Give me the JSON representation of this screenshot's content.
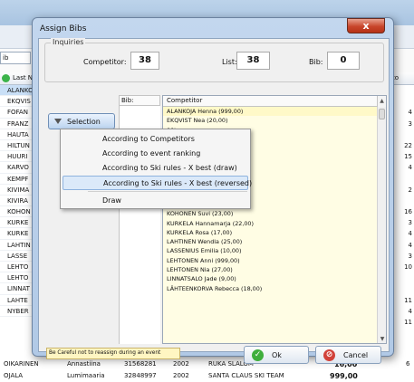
{
  "background_app": {
    "filter_text": "ib",
    "grid_header": "Last Na",
    "rows": [
      "ALANKO",
      "EKQVIS",
      "FOFAN",
      "FRANZ",
      "HAUTA",
      "HILTUN",
      "HUURI",
      "KARVO",
      "KEMPF",
      "KIVIMA",
      "KIVIRA",
      "KOHON",
      "KURKE",
      "KURKE",
      "LAHTIN",
      "LASSE",
      "LEHTO",
      "LEHTO",
      "LINNAT",
      "LAHTE",
      "NYBER"
    ],
    "right_header": "Custo",
    "right_values": [
      "",
      "",
      "4",
      "3",
      "",
      "22",
      "15",
      "4",
      "",
      "2",
      "",
      "16",
      "3",
      "4",
      "4",
      "3",
      "10",
      "",
      "",
      "11",
      "4",
      "11"
    ],
    "bottom_rows": [
      {
        "last": "OIKARINEN",
        "first": "Annastiina",
        "id": "31568281",
        "year": "2002",
        "club": "RUKA SLALOM",
        "points": "16,00",
        "extra": "6"
      },
      {
        "last": "OJALA",
        "first": "Lumimaaria",
        "id": "32848997",
        "year": "2002",
        "club": "SANTA CLAUS SKI TEAM",
        "points": "999,00",
        "extra": ""
      }
    ]
  },
  "dialog": {
    "title": "Assign Bibs",
    "close_glyph": "x",
    "inquiries": {
      "legend": "Inquiries",
      "competitor_label": "Competitor:",
      "competitor_value": "38",
      "list_label": "List:",
      "list_value": "38",
      "bib_label": "Bib:",
      "bib_value": "0"
    },
    "bib_header": "Bib:",
    "competitor_header": "Competitor",
    "competitors": [
      "ALANKOJA Henna (999,00)",
      "EKQVIST Nea (20,00)",
      "00)",
      "9,00)",
      "",
      "",
      "a (19,00)",
      "",
      "KEMPPAINEN Jemina (26,00)",
      "KIVIMÄKI Maisa (999,00)",
      "KIVIRANTA Nette (4,00)",
      "KOHONEN Suvi (23,00)",
      "KURKELA Hannamarja (22,00)",
      "KURKELA Rosa (17,00)",
      "LAHTINEN Wendla (25,00)",
      "LASSENIUS Emilia (10,00)",
      "LEHTONEN Anni (999,00)",
      "LEHTONEN Nia (27,00)",
      "LINNATSALO Jade (9,00)",
      "LÄHTEENKORVA Rebecca (18,00)"
    ],
    "selection_button": "Selection",
    "menu_items": [
      "According to Competitors",
      "According to event ranking",
      "According to Ski rules - X best (draw)",
      "According to Ski rules - X best (reversed)",
      "Draw"
    ],
    "warning": "Be Careful not to reassign during an event",
    "ok_label": "Ok",
    "cancel_label": "Cancel"
  },
  "colors": {
    "accent": "#3bb34a",
    "close_red": "#c8452b",
    "list_bg": "#fffde4",
    "highlight": "#dbe9f9"
  }
}
